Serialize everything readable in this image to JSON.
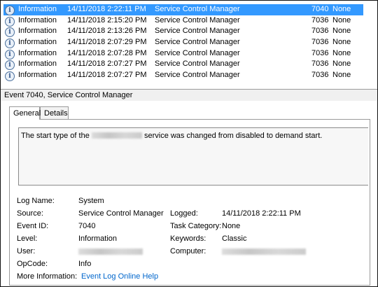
{
  "events": [
    {
      "level": "Information",
      "date": "14/11/2018 2:22:11 PM",
      "source": "Service Control Manager",
      "event_id": "7040",
      "task": "None",
      "selected": true
    },
    {
      "level": "Information",
      "date": "14/11/2018 2:15:20 PM",
      "source": "Service Control Manager",
      "event_id": "7036",
      "task": "None"
    },
    {
      "level": "Information",
      "date": "14/11/2018 2:13:26 PM",
      "source": "Service Control Manager",
      "event_id": "7036",
      "task": "None"
    },
    {
      "level": "Information",
      "date": "14/11/2018 2:07:29 PM",
      "source": "Service Control Manager",
      "event_id": "7036",
      "task": "None"
    },
    {
      "level": "Information",
      "date": "14/11/2018 2:07:28 PM",
      "source": "Service Control Manager",
      "event_id": "7036",
      "task": "None"
    },
    {
      "level": "Information",
      "date": "14/11/2018 2:07:27 PM",
      "source": "Service Control Manager",
      "event_id": "7036",
      "task": "None"
    },
    {
      "level": "Information",
      "date": "14/11/2018 2:07:27 PM",
      "source": "Service Control Manager",
      "event_id": "7036",
      "task": "None"
    }
  ],
  "detail": {
    "title": "Event 7040, Service Control Manager",
    "tabs": [
      "General",
      "Details"
    ],
    "description_before": "The start type of the",
    "description_after": "service was changed from disabled to demand start.",
    "props": {
      "log_name_label": "Log Name:",
      "log_name": "System",
      "source_label": "Source:",
      "source": "Service Control Manager",
      "logged_label": "Logged:",
      "logged": "14/11/2018 2:22:11 PM",
      "event_id_label": "Event ID:",
      "event_id": "7040",
      "task_category_label": "Task Category:",
      "task_category": "None",
      "level_label": "Level:",
      "level": "Information",
      "keywords_label": "Keywords:",
      "keywords": "Classic",
      "user_label": "User:",
      "computer_label": "Computer:",
      "opcode_label": "OpCode:",
      "opcode": "Info",
      "more_info_label": "More Information:",
      "more_info_link": "Event Log Online Help"
    }
  },
  "icons": {
    "row_icon": "information-icon"
  },
  "colors": {
    "selection": "#3399ff",
    "link": "#0066cc"
  }
}
